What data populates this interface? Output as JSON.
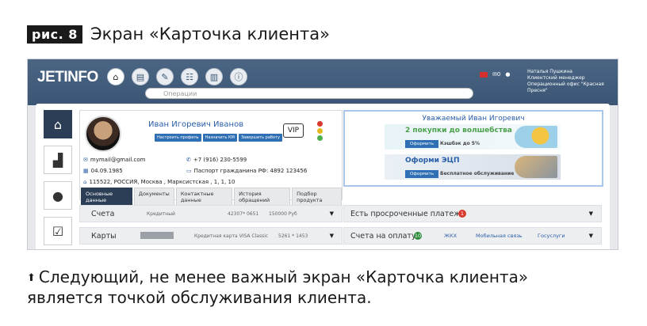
{
  "figure": {
    "badge": "рис. 8",
    "title": "Экран «Карточка клиента»",
    "caption_line1": "Следующий, не менее важный экран «Карточка клиента»",
    "caption_line2": "является точкой обслуживания клиента."
  },
  "app": {
    "logo": "JETINFO",
    "search_placeholder": "Операции",
    "notification_count": "0",
    "user": {
      "name": "Наталья Пушкина",
      "role": "Клиентский менеджер",
      "office": "Операционный офис \"Красная Пресня\""
    }
  },
  "client": {
    "name": "Иван Игоревич Иванов",
    "buttons": [
      "Настроить профиль",
      "Назначить КМ",
      "Завершить работу"
    ],
    "vip": "VIP",
    "email": "mymail@gmail.com",
    "phone": "+7 (916) 230-5599",
    "birth_date": "04.09.1985",
    "passport": "Паспорт гражданина РФ: 4892 123456",
    "address": "115522, РОССИЯ, Москва , Марксистская , 1, 1, 10",
    "tabs": [
      "Основные данные",
      "Документы",
      "Контактные данные",
      "История обращений",
      "Подбор продукта"
    ],
    "lights_colors": [
      "#d93a2e",
      "#e6b720",
      "#4caf50"
    ]
  },
  "promo": {
    "greeting": "Уважаемый Иван Игоревич",
    "banner1": {
      "title": "2 покупки до волшебства",
      "button": "Оформить",
      "subtitle": "Кэшбэк до 5%"
    },
    "banner2": {
      "title": "Оформи ЭЦП",
      "button": "Оформить",
      "subtitle": "Бесплатное обслуживание"
    }
  },
  "sections": {
    "accounts": {
      "label": "Счета",
      "type": "Кредитный",
      "number": "42307* 0651",
      "amount": "150000 Руб"
    },
    "cards": {
      "label": "Карты",
      "type": "Кредитная карта VISA Classic",
      "number": "5261 * 1453"
    },
    "overdue": {
      "label": "Есть просроченные платежи",
      "count": "1"
    },
    "bills": {
      "label": "Счета на оплату",
      "count": "10",
      "links": [
        "ЖКХ",
        "Мобильная связь",
        "Госуслуги"
      ]
    }
  }
}
